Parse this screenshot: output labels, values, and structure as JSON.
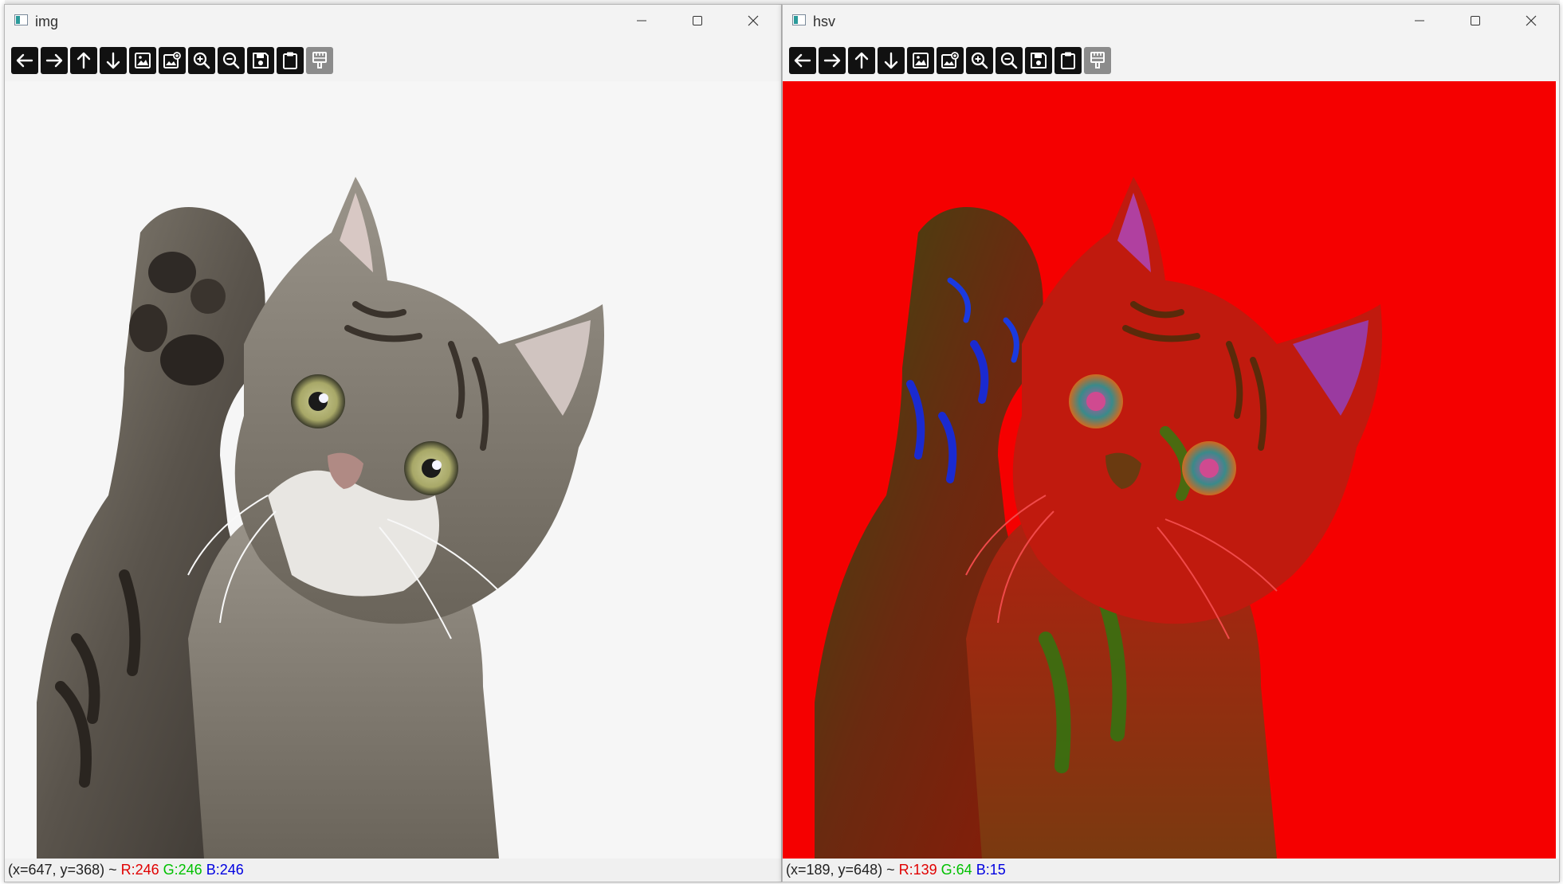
{
  "windows": [
    {
      "title": "img",
      "status": {
        "coords": "(x=647, y=368) ~ ",
        "r": "R:246",
        "g": "G:246",
        "b": "B:246"
      }
    },
    {
      "title": "hsv",
      "status": {
        "coords": "(x=189, y=648) ~ ",
        "r": "R:139",
        "g": "G:64",
        "b": "B:15"
      }
    }
  ],
  "toolbar_buttons": [
    {
      "icon": "arrow-left-icon"
    },
    {
      "icon": "arrow-right-icon"
    },
    {
      "icon": "arrow-up-icon"
    },
    {
      "icon": "arrow-down-icon"
    },
    {
      "icon": "image-icon"
    },
    {
      "icon": "image-properties-icon"
    },
    {
      "icon": "zoom-in-icon"
    },
    {
      "icon": "zoom-out-icon"
    },
    {
      "icon": "save-icon"
    },
    {
      "icon": "clipboard-icon"
    },
    {
      "icon": "settings-panel-icon"
    }
  ],
  "colors": {
    "hsv_background": "#f50000",
    "img_background": "#f6f6f6",
    "status_red": "#e00000",
    "status_green": "#00c000",
    "status_blue": "#0000e0"
  }
}
